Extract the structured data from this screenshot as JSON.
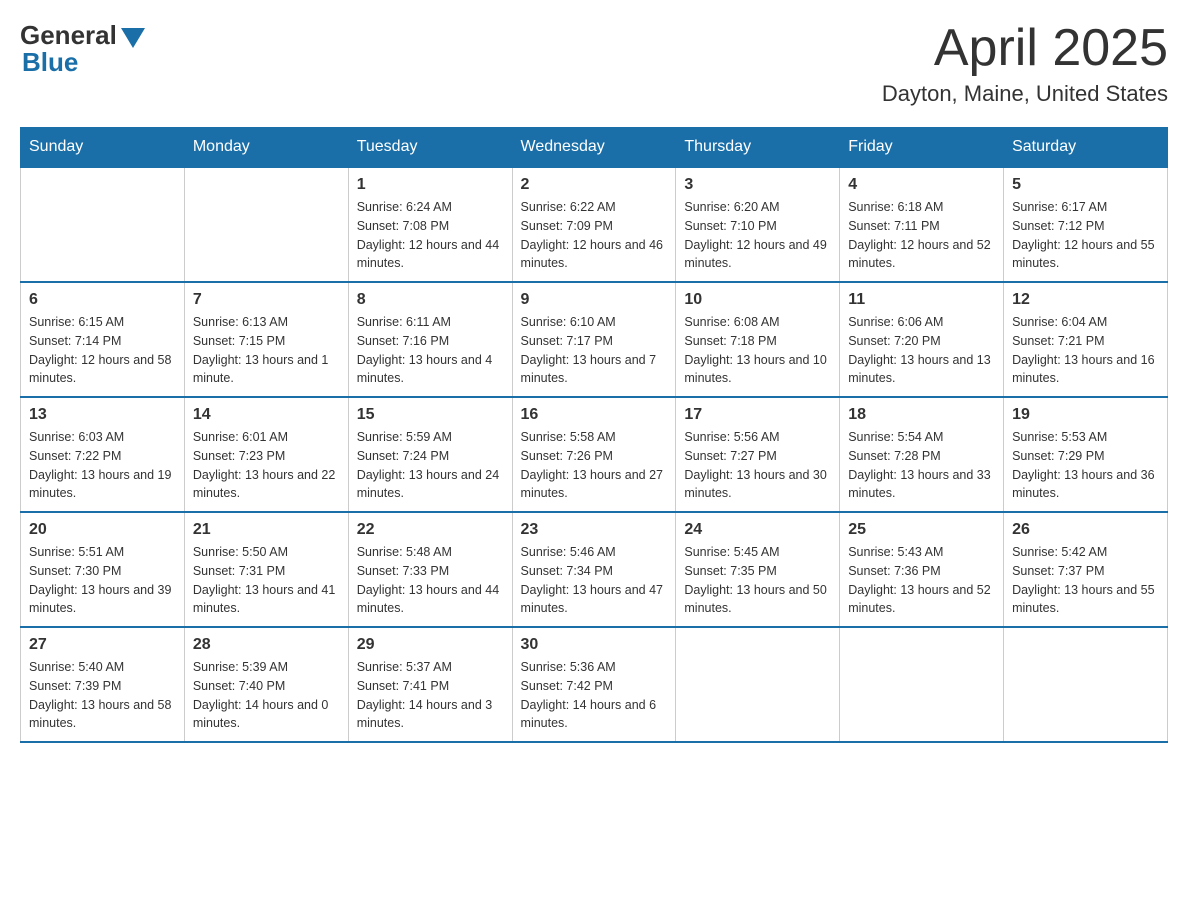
{
  "header": {
    "logo": {
      "general": "General",
      "blue": "Blue"
    },
    "title": "April 2025",
    "location": "Dayton, Maine, United States"
  },
  "days_of_week": [
    "Sunday",
    "Monday",
    "Tuesday",
    "Wednesday",
    "Thursday",
    "Friday",
    "Saturday"
  ],
  "weeks": [
    [
      null,
      null,
      {
        "day": "1",
        "sunrise": "6:24 AM",
        "sunset": "7:08 PM",
        "daylight": "12 hours and 44 minutes."
      },
      {
        "day": "2",
        "sunrise": "6:22 AM",
        "sunset": "7:09 PM",
        "daylight": "12 hours and 46 minutes."
      },
      {
        "day": "3",
        "sunrise": "6:20 AM",
        "sunset": "7:10 PM",
        "daylight": "12 hours and 49 minutes."
      },
      {
        "day": "4",
        "sunrise": "6:18 AM",
        "sunset": "7:11 PM",
        "daylight": "12 hours and 52 minutes."
      },
      {
        "day": "5",
        "sunrise": "6:17 AM",
        "sunset": "7:12 PM",
        "daylight": "12 hours and 55 minutes."
      }
    ],
    [
      {
        "day": "6",
        "sunrise": "6:15 AM",
        "sunset": "7:14 PM",
        "daylight": "12 hours and 58 minutes."
      },
      {
        "day": "7",
        "sunrise": "6:13 AM",
        "sunset": "7:15 PM",
        "daylight": "13 hours and 1 minute."
      },
      {
        "day": "8",
        "sunrise": "6:11 AM",
        "sunset": "7:16 PM",
        "daylight": "13 hours and 4 minutes."
      },
      {
        "day": "9",
        "sunrise": "6:10 AM",
        "sunset": "7:17 PM",
        "daylight": "13 hours and 7 minutes."
      },
      {
        "day": "10",
        "sunrise": "6:08 AM",
        "sunset": "7:18 PM",
        "daylight": "13 hours and 10 minutes."
      },
      {
        "day": "11",
        "sunrise": "6:06 AM",
        "sunset": "7:20 PM",
        "daylight": "13 hours and 13 minutes."
      },
      {
        "day": "12",
        "sunrise": "6:04 AM",
        "sunset": "7:21 PM",
        "daylight": "13 hours and 16 minutes."
      }
    ],
    [
      {
        "day": "13",
        "sunrise": "6:03 AM",
        "sunset": "7:22 PM",
        "daylight": "13 hours and 19 minutes."
      },
      {
        "day": "14",
        "sunrise": "6:01 AM",
        "sunset": "7:23 PM",
        "daylight": "13 hours and 22 minutes."
      },
      {
        "day": "15",
        "sunrise": "5:59 AM",
        "sunset": "7:24 PM",
        "daylight": "13 hours and 24 minutes."
      },
      {
        "day": "16",
        "sunrise": "5:58 AM",
        "sunset": "7:26 PM",
        "daylight": "13 hours and 27 minutes."
      },
      {
        "day": "17",
        "sunrise": "5:56 AM",
        "sunset": "7:27 PM",
        "daylight": "13 hours and 30 minutes."
      },
      {
        "day": "18",
        "sunrise": "5:54 AM",
        "sunset": "7:28 PM",
        "daylight": "13 hours and 33 minutes."
      },
      {
        "day": "19",
        "sunrise": "5:53 AM",
        "sunset": "7:29 PM",
        "daylight": "13 hours and 36 minutes."
      }
    ],
    [
      {
        "day": "20",
        "sunrise": "5:51 AM",
        "sunset": "7:30 PM",
        "daylight": "13 hours and 39 minutes."
      },
      {
        "day": "21",
        "sunrise": "5:50 AM",
        "sunset": "7:31 PM",
        "daylight": "13 hours and 41 minutes."
      },
      {
        "day": "22",
        "sunrise": "5:48 AM",
        "sunset": "7:33 PM",
        "daylight": "13 hours and 44 minutes."
      },
      {
        "day": "23",
        "sunrise": "5:46 AM",
        "sunset": "7:34 PM",
        "daylight": "13 hours and 47 minutes."
      },
      {
        "day": "24",
        "sunrise": "5:45 AM",
        "sunset": "7:35 PM",
        "daylight": "13 hours and 50 minutes."
      },
      {
        "day": "25",
        "sunrise": "5:43 AM",
        "sunset": "7:36 PM",
        "daylight": "13 hours and 52 minutes."
      },
      {
        "day": "26",
        "sunrise": "5:42 AM",
        "sunset": "7:37 PM",
        "daylight": "13 hours and 55 minutes."
      }
    ],
    [
      {
        "day": "27",
        "sunrise": "5:40 AM",
        "sunset": "7:39 PM",
        "daylight": "13 hours and 58 minutes."
      },
      {
        "day": "28",
        "sunrise": "5:39 AM",
        "sunset": "7:40 PM",
        "daylight": "14 hours and 0 minutes."
      },
      {
        "day": "29",
        "sunrise": "5:37 AM",
        "sunset": "7:41 PM",
        "daylight": "14 hours and 3 minutes."
      },
      {
        "day": "30",
        "sunrise": "5:36 AM",
        "sunset": "7:42 PM",
        "daylight": "14 hours and 6 minutes."
      },
      null,
      null,
      null
    ]
  ]
}
